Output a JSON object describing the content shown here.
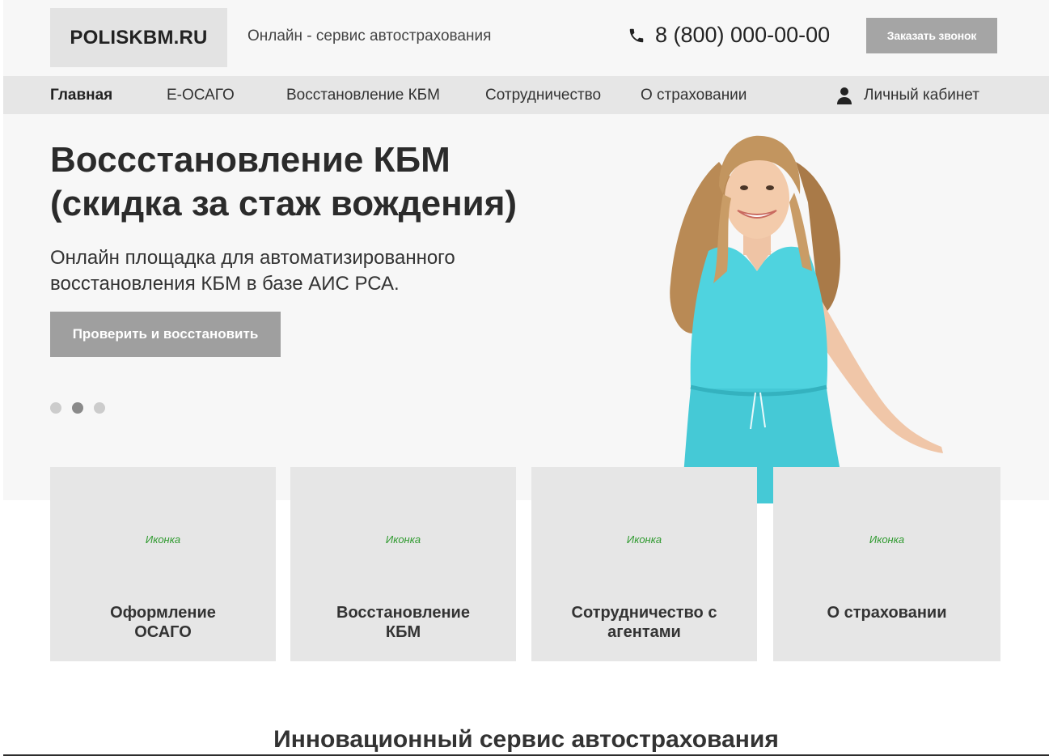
{
  "header": {
    "logo": "POLISKBM.RU",
    "tagline": "Онлайн - сервис автострахования",
    "phone": "8 (800) 000-00-00",
    "phone_icon": "phone-icon",
    "callback_button": "Заказать звонок"
  },
  "nav": {
    "items": [
      {
        "label": "Главная",
        "active": true
      },
      {
        "label": "Е-ОСАГО",
        "active": false
      },
      {
        "label": "Восстановление КБМ",
        "active": false
      },
      {
        "label": "Сотрудничество",
        "active": false
      },
      {
        "label": "О страховании",
        "active": false
      }
    ],
    "cabinet_label": "Личный кабинет",
    "cabinet_icon": "user-icon"
  },
  "hero": {
    "title_line1": "Восcстановление КБМ",
    "title_line2": "(скидка за стаж вождения)",
    "subtitle_line1": "Онлайн площадка для автоматизированного",
    "subtitle_line2": "восстановления КБМ в базе АИС РСА.",
    "button": "Проверить и восстановить",
    "slides_total": 3,
    "active_slide": 2
  },
  "cards": [
    {
      "icon_placeholder": "Иконка",
      "title_line1": "Оформление",
      "title_line2": "ОСАГО"
    },
    {
      "icon_placeholder": "Иконка",
      "title_line1": "Восстановление",
      "title_line2": "КБМ"
    },
    {
      "icon_placeholder": "Иконка",
      "title_line1": "Сотрудничество с",
      "title_line2": "агентами"
    },
    {
      "icon_placeholder": "Иконка",
      "title_line1": "О страховании",
      "title_line2": ""
    }
  ],
  "section_title": "Инновационный сервис автострахования",
  "colors": {
    "header_bg": "#f7f7f7",
    "nav_bg": "#e6e6e6",
    "button_gray": "#a5a5a5",
    "card_bg": "#e6e6e6",
    "icon_placeholder_green": "#2f9a2f",
    "dress_turquoise": "#4fd3df"
  }
}
